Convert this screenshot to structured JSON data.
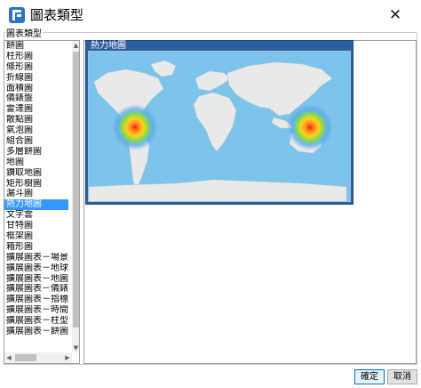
{
  "window": {
    "title": "圖表類型",
    "icon": "chart-app-icon",
    "close_glyph": "✕"
  },
  "group": {
    "label": "圖表類型"
  },
  "chart_types": {
    "items": [
      "餅圖",
      "柱形圖",
      "條形圖",
      "折線圖",
      "面積圖",
      "儀錶盤",
      "雷達圖",
      "散點圖",
      "氣泡圖",
      "組合圖",
      "多層餅圖",
      "地圖",
      "鑽取地圖",
      "矩形樹圖",
      "漏斗圖",
      "熱力地圖",
      "文字雲",
      "甘特圖",
      "框架圖",
      "箱形圖",
      "擴展圖表－場景類",
      "擴展圖表－地球類",
      "擴展圖表－地圖類",
      "擴展圖表－儀錶板",
      "擴展圖表－指標卡",
      "擴展圖表－時間類",
      "擴展圖表－柱型圖",
      "擴展圖表－餅圖類"
    ],
    "selected_index": 15
  },
  "preview": {
    "label": "熱力地圖",
    "colors": {
      "frame": "#2f5e9e",
      "ocean": "#7cc4ea",
      "land": "#e8eaea",
      "heat_hot": "#e8222c",
      "heat_mid": "#ffd21a",
      "heat_cool": "#5aa6f0"
    }
  },
  "buttons": {
    "ok": "確定",
    "cancel": "取消"
  }
}
